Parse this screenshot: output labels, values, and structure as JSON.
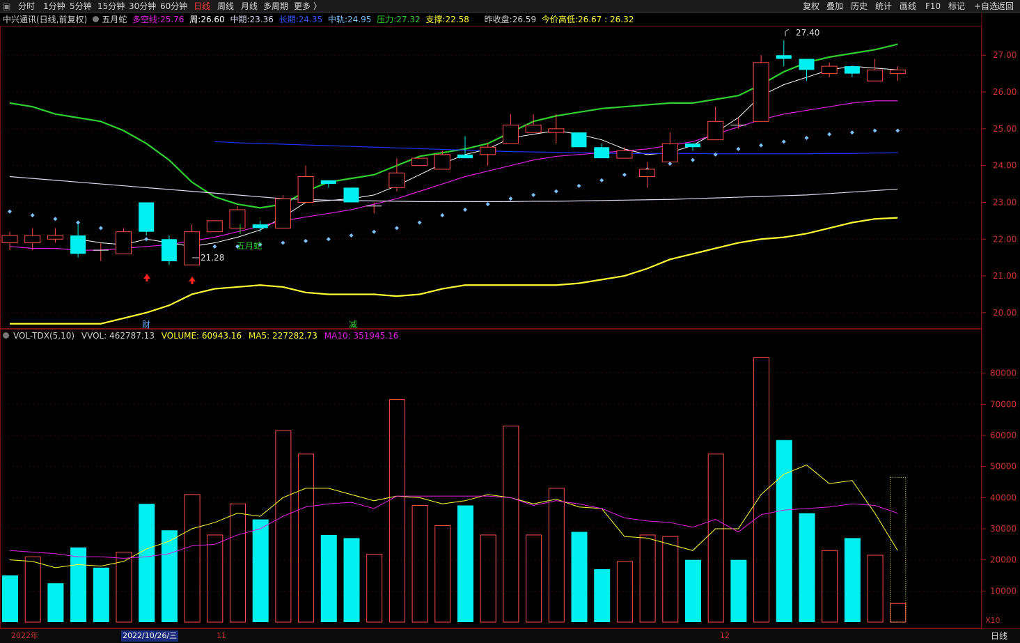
{
  "toolbar": {
    "periods": [
      "分时",
      "1分钟",
      "5分钟",
      "15分钟",
      "30分钟",
      "60分钟",
      "日线",
      "周线",
      "月线",
      "多周期",
      "更多 〉"
    ],
    "active_period": "日线",
    "right_tools": [
      "复权",
      "叠加",
      "历史",
      "统计",
      "画线",
      "F10",
      "标记",
      "+自选",
      "返回"
    ]
  },
  "info": {
    "stock": "中兴通讯(日线,前复权)",
    "indicator": "五月蛇",
    "duokong_label": "多空线:",
    "duokong_value": "25.76",
    "week_label": "周:",
    "week_value": "26.60",
    "mid_label": "中期:",
    "mid_value": "23.36",
    "long_label": "长期:",
    "long_value": "24.35",
    "zhonggui_label": "中轨:",
    "zhonggui_value": "24.95",
    "pressure_label": "压力:",
    "pressure_value": "27.32",
    "support_label": "支撑:",
    "support_value": "22.58",
    "prevclose_label": "昨收盘:",
    "prevclose_value": "26.59",
    "hl_label": "今价高低:",
    "hl_value": "26.67 : 26.32"
  },
  "volume_info": {
    "name": "VOL-TDX(5,10)",
    "vvol": "VVOL: 462787.13",
    "volume": "VOLUME: 60943.16",
    "ma5": "MA5: 227282.73",
    "ma10": "MA10: 351945.16",
    "unit": "X10"
  },
  "annotations": {
    "high_label": "27.40",
    "low_label": "21.28",
    "snake_label": "五月蛇",
    "cai_label": "财",
    "jian_label": "减"
  },
  "bottom": {
    "year": "2022年",
    "cursor_date": "2022/10/26/三",
    "month_11": "11",
    "month_12": "12",
    "period": "日线"
  },
  "colors": {
    "up": "#ff4d4d",
    "down": "#00f0f0",
    "pressure": "#2fd02f",
    "support": "#ffff33",
    "week": "#ffffff",
    "duokong": "#e020e0",
    "long": "#1e32ff",
    "mid": "#d8d8f0",
    "dots": "#7cc0ff"
  },
  "chart_data": [
    {
      "type": "candlestick",
      "title": "中兴通讯(日线,前复权)",
      "ylim": [
        19.6,
        27.8
      ],
      "ticks": [
        20.0,
        21.0,
        22.0,
        23.0,
        24.0,
        25.0,
        26.0,
        27.0
      ],
      "candles": [
        {
          "o": 21.9,
          "h": 22.2,
          "l": 21.7,
          "c": 22.1
        },
        {
          "o": 21.9,
          "h": 22.3,
          "l": 21.7,
          "c": 22.1
        },
        {
          "o": 22.0,
          "h": 22.3,
          "l": 21.9,
          "c": 22.1
        },
        {
          "o": 22.1,
          "h": 22.4,
          "l": 21.5,
          "c": 21.6
        },
        {
          "o": 21.7,
          "h": 21.9,
          "l": 21.4,
          "c": 21.7
        },
        {
          "o": 21.6,
          "h": 22.3,
          "l": 21.6,
          "c": 22.2
        },
        {
          "o": 23.0,
          "h": 23.0,
          "l": 22.1,
          "c": 22.2
        },
        {
          "o": 22.0,
          "h": 22.1,
          "l": 21.3,
          "c": 21.4
        },
        {
          "o": 21.3,
          "h": 22.4,
          "l": 21.3,
          "c": 22.2
        },
        {
          "o": 22.2,
          "h": 22.5,
          "l": 22.2,
          "c": 22.5
        },
        {
          "o": 22.3,
          "h": 22.9,
          "l": 22.3,
          "c": 22.8
        },
        {
          "o": 22.4,
          "h": 22.5,
          "l": 22.2,
          "c": 22.3
        },
        {
          "o": 22.3,
          "h": 23.2,
          "l": 22.3,
          "c": 23.1
        },
        {
          "o": 23.0,
          "h": 24.0,
          "l": 23.0,
          "c": 23.7
        },
        {
          "o": 23.6,
          "h": 23.6,
          "l": 23.4,
          "c": 23.5
        },
        {
          "o": 23.4,
          "h": 23.4,
          "l": 23.0,
          "c": 23.0
        },
        {
          "o": 22.9,
          "h": 23.0,
          "l": 22.7,
          "c": 22.9
        },
        {
          "o": 23.4,
          "h": 24.2,
          "l": 23.3,
          "c": 23.8
        },
        {
          "o": 24.0,
          "h": 24.2,
          "l": 24.0,
          "c": 24.2
        },
        {
          "o": 23.9,
          "h": 24.4,
          "l": 23.9,
          "c": 24.3
        },
        {
          "o": 24.3,
          "h": 24.8,
          "l": 24.2,
          "c": 24.2
        },
        {
          "o": 24.3,
          "h": 24.6,
          "l": 24.0,
          "c": 24.5
        },
        {
          "o": 24.6,
          "h": 25.4,
          "l": 24.6,
          "c": 25.1
        },
        {
          "o": 24.9,
          "h": 25.4,
          "l": 24.9,
          "c": 25.1
        },
        {
          "o": 24.9,
          "h": 25.4,
          "l": 24.6,
          "c": 25.0
        },
        {
          "o": 24.9,
          "h": 24.9,
          "l": 24.5,
          "c": 24.5
        },
        {
          "o": 24.5,
          "h": 24.6,
          "l": 24.2,
          "c": 24.2
        },
        {
          "o": 24.2,
          "h": 24.5,
          "l": 24.2,
          "c": 24.4
        },
        {
          "o": 23.7,
          "h": 24.1,
          "l": 23.4,
          "c": 23.9
        },
        {
          "o": 24.1,
          "h": 24.9,
          "l": 24.1,
          "c": 24.6
        },
        {
          "o": 24.6,
          "h": 24.6,
          "l": 24.4,
          "c": 24.5
        },
        {
          "o": 24.7,
          "h": 25.6,
          "l": 24.7,
          "c": 25.2
        },
        {
          "o": 25.1,
          "h": 25.3,
          "l": 25.0,
          "c": 25.1
        },
        {
          "o": 25.2,
          "h": 27.0,
          "l": 25.2,
          "c": 26.8
        },
        {
          "o": 27.0,
          "h": 27.4,
          "l": 26.7,
          "c": 26.9
        },
        {
          "o": 26.9,
          "h": 26.9,
          "l": 26.3,
          "c": 26.6
        },
        {
          "o": 26.5,
          "h": 26.8,
          "l": 26.4,
          "c": 26.7
        },
        {
          "o": 26.7,
          "h": 26.7,
          "l": 26.4,
          "c": 26.5
        },
        {
          "o": 26.3,
          "h": 26.9,
          "l": 26.3,
          "c": 26.6
        },
        {
          "o": 26.5,
          "h": 26.7,
          "l": 26.3,
          "c": 26.6
        }
      ],
      "series": [
        {
          "name": "压力",
          "values": [
            25.7,
            25.6,
            25.4,
            25.3,
            25.2,
            24.95,
            24.6,
            24.15,
            23.55,
            23.15,
            22.95,
            22.85,
            22.95,
            23.3,
            23.55,
            23.65,
            23.75,
            24.0,
            24.25,
            24.35,
            24.45,
            24.6,
            24.9,
            25.2,
            25.35,
            25.45,
            25.55,
            25.6,
            25.65,
            25.7,
            25.7,
            25.8,
            25.9,
            26.2,
            26.55,
            26.8,
            26.95,
            27.05,
            27.15,
            27.3
          ]
        },
        {
          "name": "支撑",
          "values": [
            19.7,
            19.7,
            19.7,
            19.7,
            19.7,
            19.85,
            20.0,
            20.2,
            20.5,
            20.65,
            20.7,
            20.75,
            20.7,
            20.55,
            20.5,
            20.5,
            20.5,
            20.45,
            20.5,
            20.65,
            20.75,
            20.75,
            20.75,
            20.75,
            20.75,
            20.8,
            20.9,
            21.0,
            21.2,
            21.45,
            21.6,
            21.75,
            21.9,
            22.0,
            22.05,
            22.15,
            22.3,
            22.45,
            22.55,
            22.58
          ]
        },
        {
          "name": "周",
          "values": [
            null,
            null,
            null,
            22.0,
            21.9,
            21.85,
            22.0,
            21.9,
            21.8,
            21.9,
            22.05,
            22.25,
            22.6,
            23.0,
            23.05,
            23.1,
            23.2,
            23.45,
            23.75,
            24.05,
            24.3,
            24.45,
            24.75,
            24.85,
            24.95,
            24.85,
            24.7,
            24.45,
            24.3,
            24.35,
            24.55,
            24.9,
            25.3,
            25.9,
            26.2,
            26.4,
            26.6,
            26.7,
            26.65,
            26.6
          ]
        },
        {
          "name": "多空线",
          "values": [
            21.8,
            21.75,
            21.75,
            21.7,
            21.7,
            21.75,
            21.8,
            21.85,
            21.95,
            22.05,
            22.2,
            22.35,
            22.5,
            22.6,
            22.7,
            22.8,
            22.95,
            23.1,
            23.3,
            23.5,
            23.7,
            23.85,
            24.0,
            24.15,
            24.25,
            24.3,
            24.35,
            24.4,
            24.45,
            24.55,
            24.65,
            24.85,
            25.05,
            25.25,
            25.4,
            25.5,
            25.6,
            25.7,
            25.76,
            25.76
          ]
        },
        {
          "name": "长期",
          "values": [
            null,
            null,
            null,
            null,
            null,
            null,
            null,
            null,
            null,
            24.65,
            24.62,
            24.6,
            24.58,
            24.56,
            24.54,
            24.52,
            24.5,
            24.48,
            24.46,
            24.44,
            24.42,
            24.4,
            24.38,
            24.37,
            24.36,
            24.35,
            24.34,
            24.33,
            24.33,
            24.33,
            24.33,
            24.32,
            24.32,
            24.32,
            24.32,
            24.32,
            24.33,
            24.33,
            24.34,
            24.35
          ]
        },
        {
          "name": "中期",
          "values": [
            23.7,
            23.65,
            23.6,
            23.55,
            23.5,
            23.45,
            23.4,
            23.35,
            23.3,
            23.25,
            23.2,
            23.15,
            23.1,
            23.08,
            23.06,
            23.05,
            23.04,
            23.03,
            23.02,
            23.02,
            23.02,
            23.02,
            23.02,
            23.03,
            23.03,
            23.04,
            23.05,
            23.06,
            23.07,
            23.08,
            23.1,
            23.12,
            23.14,
            23.16,
            23.18,
            23.2,
            23.24,
            23.28,
            23.32,
            23.36
          ]
        },
        {
          "name": "中轨",
          "values": [
            22.75,
            22.65,
            22.55,
            22.45,
            22.3,
            22.15,
            22.0,
            21.9,
            21.8,
            21.8,
            21.8,
            21.85,
            21.9,
            21.95,
            22.0,
            22.1,
            22.2,
            22.3,
            22.45,
            22.65,
            22.8,
            22.95,
            23.1,
            23.2,
            23.3,
            23.45,
            23.6,
            23.75,
            23.9,
            24.05,
            24.15,
            24.3,
            24.45,
            24.55,
            24.65,
            24.75,
            24.85,
            24.9,
            24.95,
            24.95
          ]
        }
      ]
    },
    {
      "type": "bar",
      "title": "VOL-TDX(5,10)",
      "ylim": [
        0,
        90000
      ],
      "ticks": [
        10000,
        20000,
        30000,
        40000,
        50000,
        60000,
        70000,
        80000
      ],
      "values": [
        15000,
        21000,
        12500,
        24000,
        17500,
        22500,
        38000,
        29500,
        41000,
        28000,
        38000,
        33000,
        61500,
        54000,
        28000,
        27000,
        21800,
        71500,
        37500,
        31000,
        37500,
        28000,
        63000,
        28000,
        43000,
        29000,
        17000,
        19500,
        28000,
        27500,
        20000,
        54000,
        20000,
        85000,
        58500,
        35000,
        23000,
        27000,
        21500,
        6000
      ],
      "up": [
        false,
        true,
        false,
        false,
        false,
        true,
        false,
        false,
        true,
        true,
        true,
        false,
        true,
        true,
        false,
        false,
        true,
        true,
        true,
        true,
        false,
        true,
        true,
        true,
        true,
        false,
        false,
        true,
        true,
        true,
        false,
        true,
        false,
        true,
        false,
        false,
        true,
        false,
        true,
        true
      ],
      "series": [
        {
          "name": "MA5",
          "values": [
            20000,
            19500,
            17500,
            18500,
            18000,
            19500,
            23500,
            26000,
            30000,
            32000,
            35000,
            34000,
            40000,
            43000,
            43000,
            41000,
            39000,
            40500,
            40000,
            38000,
            39000,
            41000,
            40000,
            38000,
            39500,
            37000,
            36500,
            27500,
            27000,
            25000,
            23000,
            30000,
            30000,
            41000,
            47500,
            50500,
            44500,
            45500,
            35000,
            23000
          ]
        },
        {
          "name": "MA10",
          "values": [
            23000,
            22500,
            22000,
            21000,
            21000,
            20500,
            21000,
            22000,
            24500,
            25000,
            28000,
            30000,
            34000,
            37000,
            38000,
            38500,
            36500,
            40500,
            40500,
            40500,
            40500,
            40500,
            40000,
            37500,
            39000,
            38000,
            36500,
            33500,
            32500,
            32000,
            30500,
            33000,
            29000,
            34500,
            36000,
            36500,
            37000,
            38000,
            37500,
            35000
          ]
        }
      ]
    }
  ]
}
